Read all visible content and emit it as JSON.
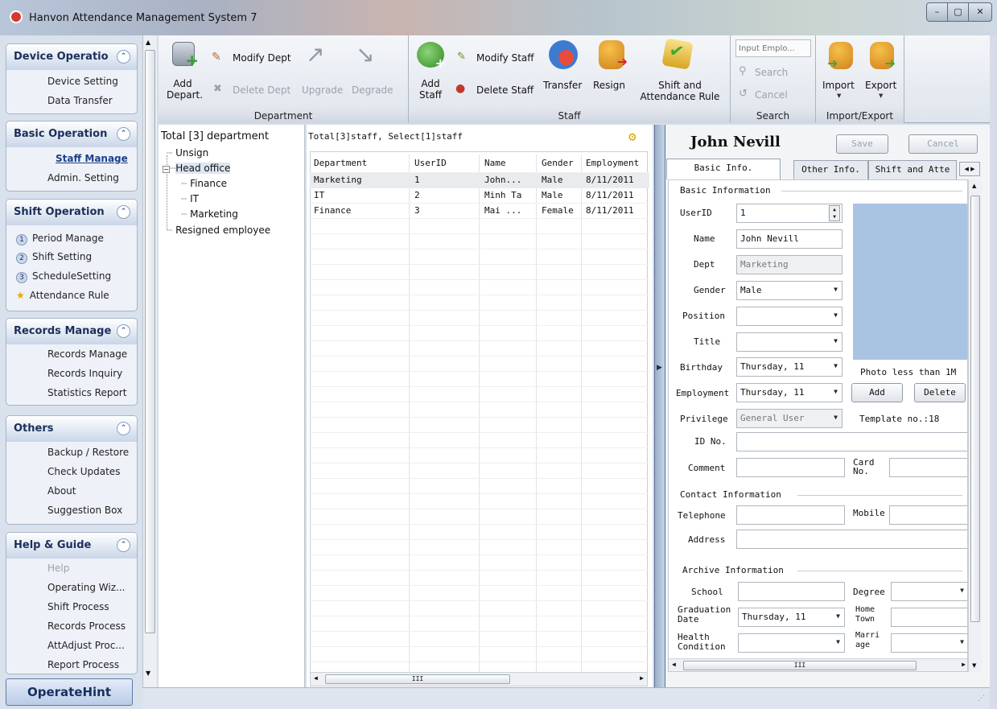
{
  "window": {
    "title": "Hanvon Attendance Management System 7",
    "minimize": "–",
    "maximize": "▢",
    "close": "✕"
  },
  "sidebar": {
    "groups": [
      {
        "title": "Device Operatio",
        "items": [
          "Device Setting",
          "Data Transfer"
        ]
      },
      {
        "title": "Basic Operation",
        "items": [
          "Staff Manage",
          "Admin. Setting"
        ]
      },
      {
        "title": "Shift Operation",
        "items": [
          "Period Manage",
          "Shift Setting",
          "ScheduleSetting",
          "Attendance Rule"
        ],
        "numbers": [
          "1",
          "2",
          "3"
        ]
      },
      {
        "title": "Records Manage",
        "items": [
          "Records Manage",
          "Records Inquiry",
          "Statistics Report"
        ]
      },
      {
        "title": "Others",
        "items": [
          "Backup / Restore",
          "Check Updates",
          "About",
          "Suggestion Box"
        ]
      },
      {
        "title": "Help & Guide",
        "items": [
          "Help",
          "Operating Wiz...",
          "Shift Process",
          "Records Process",
          "AttAdjust Proc...",
          "Report Process"
        ]
      }
    ],
    "operate_hint": "OperateHint"
  },
  "ribbon": {
    "department": {
      "label": "Department",
      "add": "Add",
      "add2": "Depart.",
      "modify": "Modify Dept",
      "delete": "Delete Dept",
      "upgrade": "Upgrade",
      "degrade": "Degrade"
    },
    "staff": {
      "label": "Staff",
      "add": "Add",
      "add2": "Staff",
      "modify": "Modify Staff",
      "delete": "Delete Staff",
      "transfer": "Transfer",
      "resign": "Resign",
      "shift_rule": "Shift and",
      "shift_rule2": "Attendance Rule"
    },
    "search": {
      "label": "Search",
      "placeholder": "Input Emplo...",
      "search": "Search",
      "cancel": "Cancel"
    },
    "import_export": {
      "label": "Import/Export",
      "import": "Import",
      "export": "Export"
    }
  },
  "tree": {
    "header": "Total [3] department",
    "nodes": [
      "Unsign",
      "Head office",
      "Finance",
      "IT",
      "Marketing",
      "Resigned employee"
    ]
  },
  "grid": {
    "summary": "Total[3]staff, Select[1]staff",
    "columns": [
      "Department",
      "UserID",
      "Name",
      "Gender",
      "Employment"
    ],
    "rows": [
      [
        "Marketing",
        "1",
        "John...",
        "Male",
        "8/11/2011"
      ],
      [
        "IT",
        "2",
        "Minh Ta",
        "Male",
        "8/11/2011"
      ],
      [
        "Finance",
        "3",
        "Mai ...",
        "Female",
        "8/11/2011"
      ]
    ],
    "hscroll": "III"
  },
  "detail": {
    "name": "John Nevill",
    "save": "Save",
    "cancel": "Cancel",
    "tabs": [
      "Basic Info.",
      "Other Info.",
      "Shift and Atte"
    ],
    "basic_section": "Basic Information",
    "labels": {
      "userid": "UserID",
      "name": "Name",
      "dept": "Dept",
      "gender": "Gender",
      "position": "Position",
      "title": "Title",
      "birthday": "Birthday",
      "employment": "Employment",
      "privilege": "Privilege",
      "idno": "ID No.",
      "comment": "Comment",
      "card": "Card",
      "card2": "No."
    },
    "values": {
      "userid": "1",
      "name": "John Nevill",
      "dept": "Marketing",
      "gender": "Male",
      "position": "",
      "title": "",
      "birthday": "Thursday, 11",
      "employment": "Thursday, 11",
      "privilege": "General User"
    },
    "photo_note": "Photo less than 1M",
    "photo_add": "Add",
    "photo_delete": "Delete",
    "template": "Template no.:18",
    "contact_section": "Contact Information",
    "contact_labels": {
      "telephone": "Telephone",
      "mobile": "Mobile",
      "address": "Address"
    },
    "archive_section": "Archive Information",
    "archive_labels": {
      "school": "School",
      "degree": "Degree",
      "grad1": "Graduation",
      "grad2": "Date",
      "home1": "Home",
      "home2": "Town",
      "health1": "Health",
      "health2": "Condition",
      "marr1": "Marri",
      "marr2": "age"
    },
    "archive_values": {
      "grad_date": "Thursday, 11"
    },
    "hscroll": "III"
  }
}
